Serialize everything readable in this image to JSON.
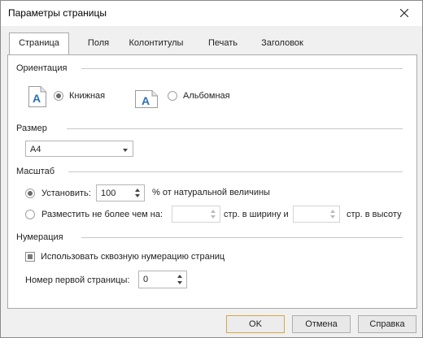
{
  "window": {
    "title": "Параметры страницы"
  },
  "tabs": [
    {
      "label": "Страница",
      "active": true
    },
    {
      "label": "Поля"
    },
    {
      "label": "Колонтитулы"
    },
    {
      "label": "Печать"
    },
    {
      "label": "Заголовок"
    }
  ],
  "orientation": {
    "heading": "Ориентация",
    "portrait_label": "Книжная",
    "landscape_label": "Альбомная",
    "selected": "portrait",
    "icon_letter": "A"
  },
  "size": {
    "heading": "Размер",
    "selected_value": "A4"
  },
  "scale": {
    "heading": "Масштаб",
    "set_label": "Установить:",
    "set_value": "100",
    "percent_label": "% от натуральной величины",
    "fit_label": "Разместить не более чем на:",
    "width_value": "",
    "width_label": "стр. в ширину и",
    "height_value": "",
    "height_label": "стр. в высоту",
    "selected": "set"
  },
  "numbering": {
    "heading": "Нумерация",
    "continuous_label": "Использовать сквозную нумерацию страниц",
    "first_page_label": "Номер первой страницы:",
    "first_page_value": "0"
  },
  "buttons": {
    "ok": "OK",
    "cancel": "Отмена",
    "help": "Справка"
  },
  "colors": {
    "accent_default_border": "#d7a64a",
    "icon_blue": "#2e6fb7"
  }
}
